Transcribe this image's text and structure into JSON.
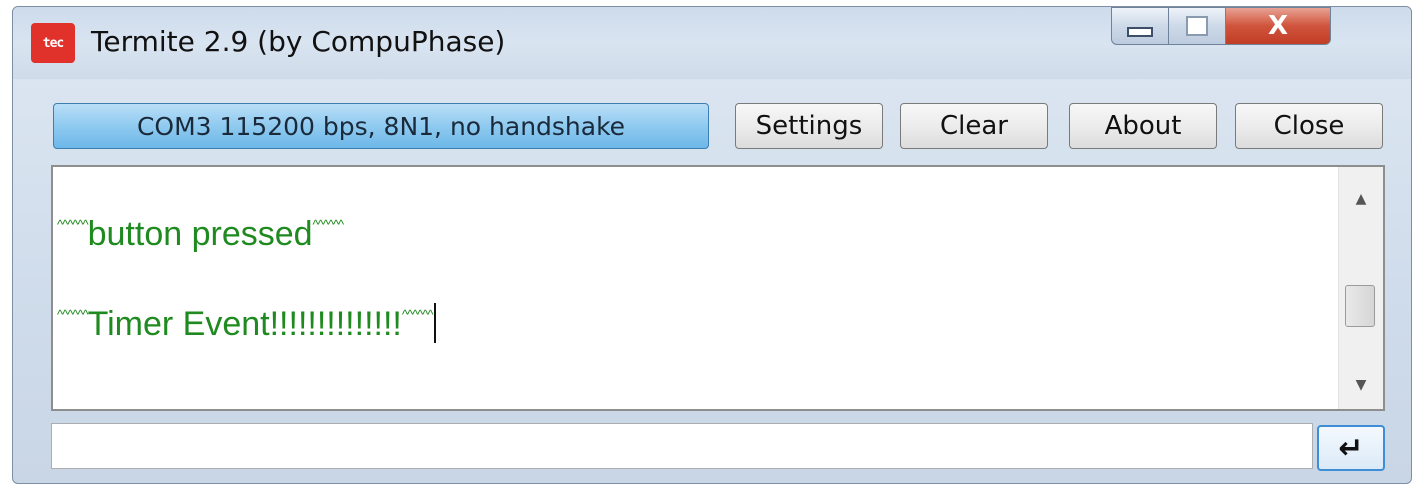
{
  "window": {
    "title": "Termite 2.9 (by CompuPhase)",
    "icon": "termite-app-icon",
    "icon_text": "tec",
    "caption_buttons": {
      "minimize_icon": "minimize-icon",
      "maximize_icon": "maximize-icon",
      "close_label": "X"
    }
  },
  "toolbar": {
    "connection_status": "COM3 115200 bps, 8N1, no handshake",
    "settings_label": "Settings",
    "clear_label": "Clear",
    "about_label": "About",
    "close_label": "Close"
  },
  "terminal": {
    "lines": [
      {
        "prefix": "^^^^^^",
        "text": "button pressed",
        "suffix": "^^^^^^"
      },
      {
        "prefix": "^^^^^^",
        "text": "Timer Event!!!!!!!!!!!!!!",
        "suffix": "^^^^^^"
      }
    ],
    "text_color": "#1f8a1f"
  },
  "scrollbar": {
    "up_glyph": "▲",
    "down_glyph": "▼"
  },
  "input": {
    "value": "",
    "placeholder": ""
  },
  "send_button": {
    "glyph": "↵",
    "icon": "enter-icon"
  },
  "colors": {
    "connection_button": "#8fcaf0",
    "close_button": "#d0543d"
  }
}
